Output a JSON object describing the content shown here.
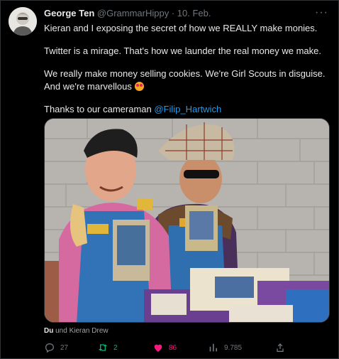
{
  "author": {
    "name": "George Ten",
    "handle": "@GrammarHippy",
    "sep": " · ",
    "date": "10. Feb."
  },
  "more_label": "···",
  "body": {
    "p1": "Kieran and I exposing the secret of how we REALLY make monies.",
    "p2": "Twitter is a mirage. That's how we launder the real money we make.",
    "p3": "We really make money selling cookies. We're Girl Scouts in disguise. And we're marvellous",
    "p4_prefix": "Thanks to our cameraman ",
    "p4_mention": "@Filip_Hartwich"
  },
  "tagged": {
    "you": "Du",
    "rest": " und Kieran Drew"
  },
  "actions": {
    "replies": "27",
    "reposts": "2",
    "likes": "86",
    "views": "9.785"
  },
  "colors": {
    "background": "#000000",
    "text": "#e7e9ea",
    "muted": "#71767b",
    "link": "#1d9bf0",
    "repost": "#00ba7c",
    "like": "#f91880"
  },
  "icons": [
    "more-icon",
    "reply-icon",
    "repost-icon",
    "like-icon",
    "views-icon",
    "share-icon",
    "starstruck-emoji-icon"
  ]
}
